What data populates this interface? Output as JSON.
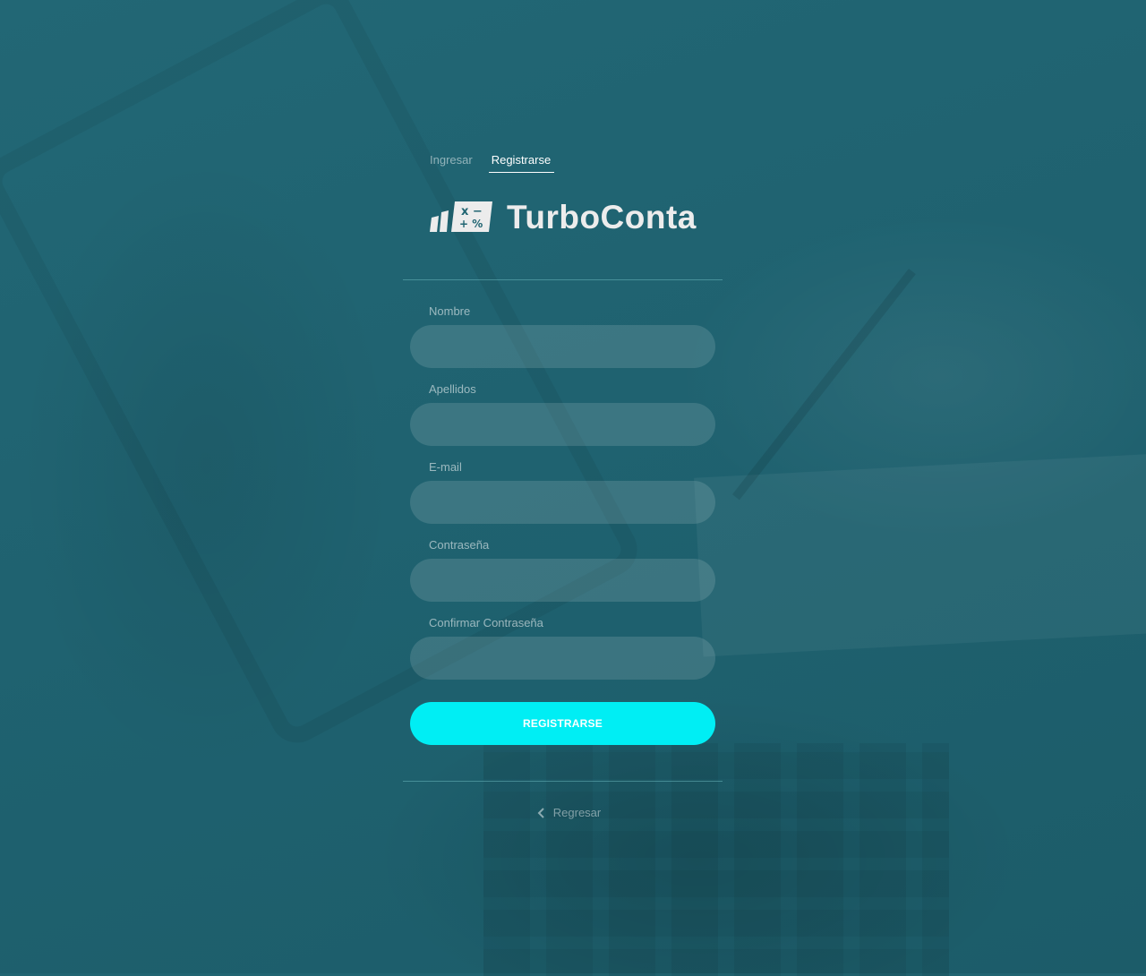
{
  "tabs": [
    {
      "label": "Ingresar",
      "active": false
    },
    {
      "label": "Registrarse",
      "active": true
    }
  ],
  "brand": {
    "name": "TurboConta",
    "logo_glyphs": {
      "top": "x −",
      "bottom": "+ %"
    },
    "logo_icon": "calculator-chart-icon"
  },
  "form": {
    "fields": [
      {
        "label": "Nombre",
        "value": "",
        "type": "text"
      },
      {
        "label": "Apellidos",
        "value": "",
        "type": "text"
      },
      {
        "label": "E-mail",
        "value": "",
        "type": "email"
      },
      {
        "label": "Contraseña",
        "value": "",
        "type": "password"
      },
      {
        "label": "Confirmar Contraseña",
        "value": "",
        "type": "password"
      }
    ],
    "submit_label": "REGISTRARSE"
  },
  "back": {
    "label": "Regresar",
    "icon": "chevron-left-icon"
  },
  "colors": {
    "background": "#216572",
    "accent": "#00eef4",
    "input_fill": "rgba(255,255,255,0.13)"
  }
}
